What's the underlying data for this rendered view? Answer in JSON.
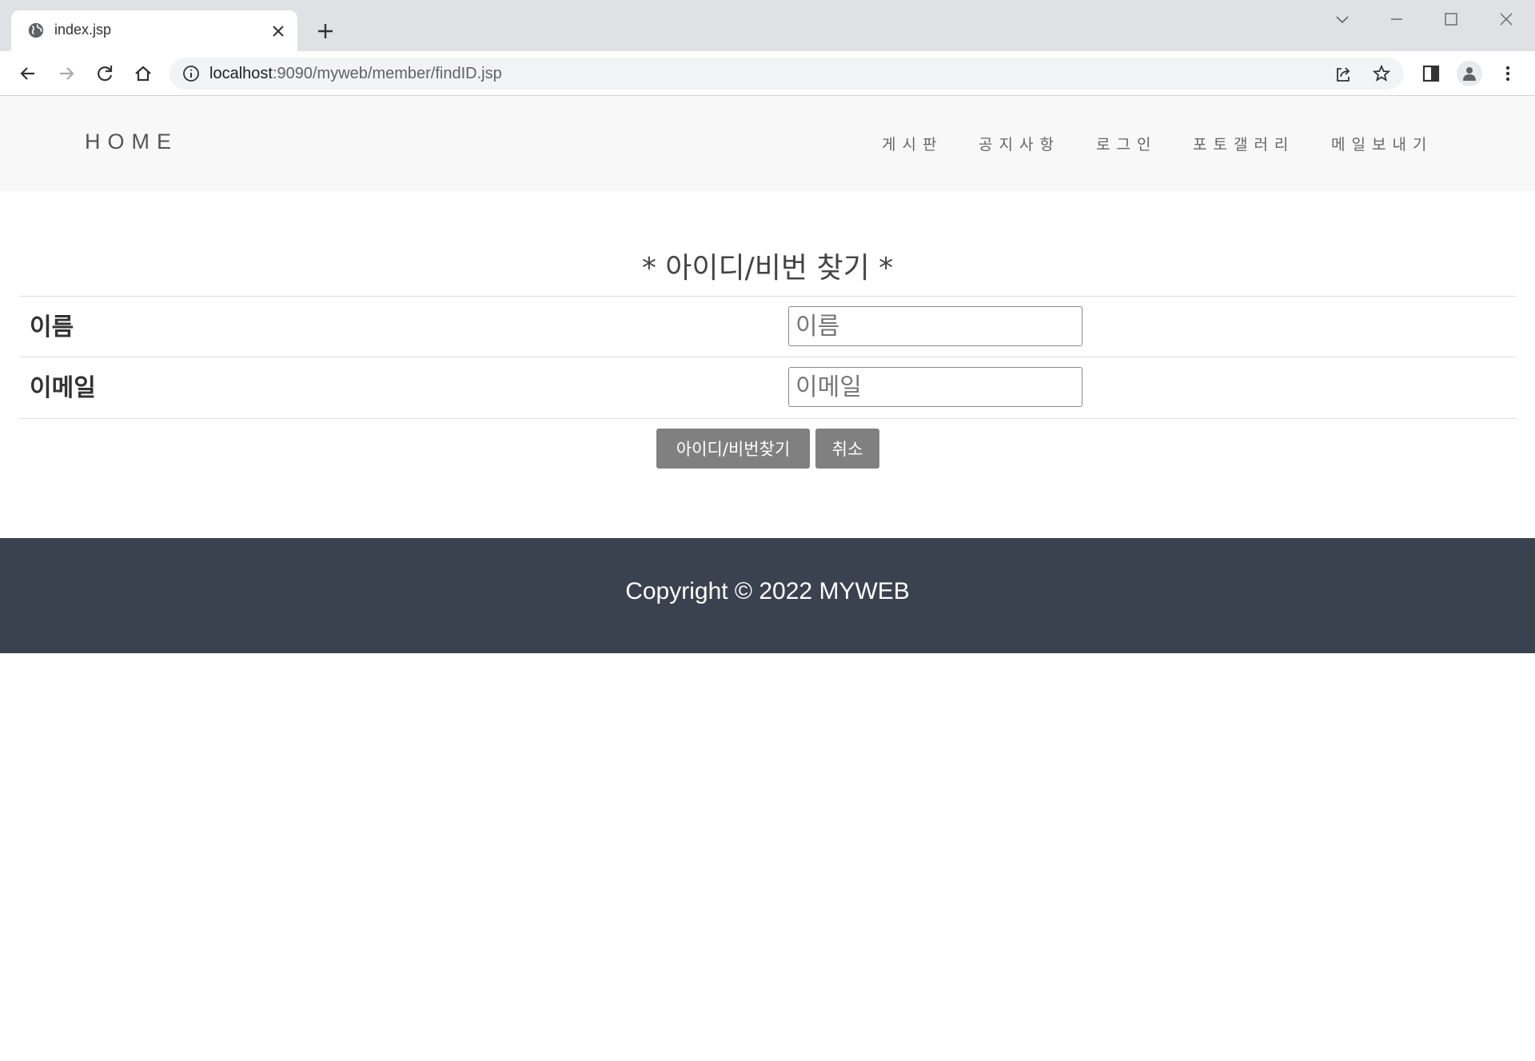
{
  "browser": {
    "tab_title": "index.jsp",
    "url_host": "localhost",
    "url_path": ":9090/myweb/member/findID.jsp"
  },
  "site": {
    "brand": "HOME",
    "menu": [
      {
        "label": "게시판"
      },
      {
        "label": "공지사항"
      },
      {
        "label": "로그인"
      },
      {
        "label": "포토갤러리"
      },
      {
        "label": "메일보내기"
      }
    ]
  },
  "form": {
    "title": "* 아이디/비번 찾기 *",
    "name_label": "이름",
    "name_placeholder": "이름",
    "email_label": "이메일",
    "email_placeholder": "이메일",
    "submit_label": "아이디/비번찾기",
    "cancel_label": "취소"
  },
  "footer": {
    "copyright": "Copyright © 2022 MYWEB"
  },
  "colors": {
    "nav_bg": "#f8f8f8",
    "footer_bg": "#3b424f",
    "button_bg": "#808080"
  }
}
